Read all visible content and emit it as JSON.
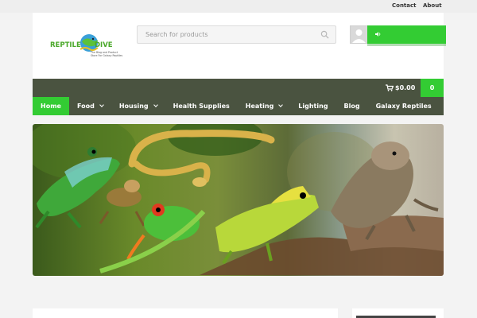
{
  "topbar": {
    "links": [
      "Contact",
      "About"
    ]
  },
  "header": {
    "logo": {
      "word1": "REPTILE",
      "word2": "DIVE",
      "tagline": "The Blog and Product Store For Galaxy Reptiles"
    },
    "search": {
      "placeholder": "Search for products"
    }
  },
  "nav": {
    "cart_total": "$0.00",
    "cart_count": "0",
    "menu": [
      {
        "label": "Home",
        "active": true,
        "dropdown": false
      },
      {
        "label": "Food",
        "active": false,
        "dropdown": true
      },
      {
        "label": "Housing",
        "active": false,
        "dropdown": true
      },
      {
        "label": "Health Supplies",
        "active": false,
        "dropdown": false
      },
      {
        "label": "Heating",
        "active": false,
        "dropdown": true
      },
      {
        "label": "Lighting",
        "active": false,
        "dropdown": false
      },
      {
        "label": "Blog",
        "active": false,
        "dropdown": false
      },
      {
        "label": "Galaxy Reptiles",
        "active": false,
        "dropdown": false
      }
    ]
  },
  "colors": {
    "accent": "#33cc33",
    "nav_bg": "#4a5340",
    "logo_green": "#4aa82a"
  },
  "icons": [
    "search-icon",
    "speaker-icon",
    "cart-icon",
    "chevron-down-icon",
    "avatar"
  ]
}
